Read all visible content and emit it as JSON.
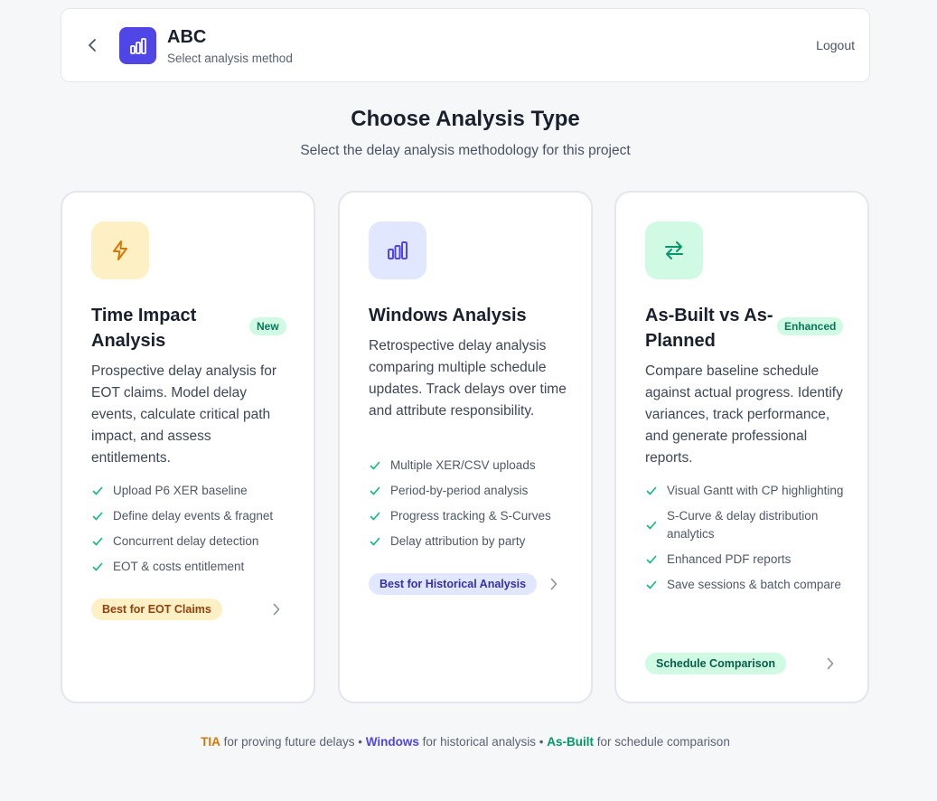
{
  "header": {
    "title": "ABC",
    "subtitle": "Select analysis method",
    "logout_label": "Logout",
    "logo_icon": "bar-chart-icon",
    "back_icon": "chevron-left-icon"
  },
  "page": {
    "title": "Choose Analysis Type",
    "subtitle": "Select the delay analysis methodology for this project"
  },
  "cards": [
    {
      "icon": "lightning-bolt-icon",
      "title": "Time Impact Analysis",
      "badge": "New",
      "description": "Prospective delay analysis for EOT claims. Model delay events, calculate critical path impact, and assess entitlements.",
      "features": [
        "Upload P6 XER baseline",
        "Define delay events & fragnet",
        "Concurrent delay detection",
        "EOT & costs entitlement"
      ],
      "tag": "Best for EOT Claims",
      "accent": "#d97706"
    },
    {
      "icon": "bar-chart-icon",
      "title": "Windows Analysis",
      "description": "Retrospective delay analysis comparing multiple schedule updates. Track delays over time and attribute responsibility.",
      "features": [
        "Multiple XER/CSV uploads",
        "Period-by-period analysis",
        "Progress tracking & S-Curves",
        "Delay attribution by party"
      ],
      "tag": "Best for Historical Analysis",
      "accent": "#4f46e5"
    },
    {
      "icon": "swap-arrows-icon",
      "title": "As-Built vs As-Planned",
      "badge": "Enhanced",
      "description": "Compare baseline schedule against actual progress. Identify variances, track performance, and generate professional reports.",
      "features": [
        "Visual Gantt with CP highlighting",
        "S-Curve & delay distribution analytics",
        "Enhanced PDF reports",
        "Save sessions & batch compare"
      ],
      "tag": "Schedule Comparison",
      "accent": "#059669"
    }
  ],
  "footer": {
    "tia": "TIA",
    "tia_text": "for proving future delays",
    "sep": "•",
    "windows": "Windows",
    "windows_text": "for historical analysis",
    "asbuilt": "As-Built",
    "asbuilt_text": "for schedule comparison"
  }
}
